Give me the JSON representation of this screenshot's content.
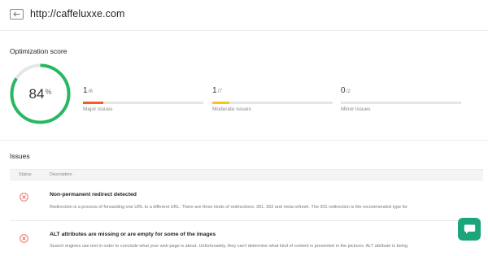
{
  "header": {
    "back_icon": "arrow-left-icon",
    "url": "http://caffeluxxe.com"
  },
  "score": {
    "title": "Optimization score",
    "value": "84",
    "unit": "%",
    "fraction": 0.84,
    "color": "#27b862"
  },
  "stats": [
    {
      "count": "1",
      "total": "/6",
      "label": "Major issues",
      "fraction": 0.167,
      "color": "#f25b2a"
    },
    {
      "count": "1",
      "total": "/7",
      "label": "Moderate issues",
      "fraction": 0.143,
      "color": "#f5c523"
    },
    {
      "count": "0",
      "total": "/2",
      "label": "Minor issues",
      "fraction": 0,
      "color": "#27b862"
    }
  ],
  "issues": {
    "title": "Issues",
    "columns": {
      "status": "Status",
      "description": "Description"
    },
    "rows": [
      {
        "icon": "error-x-icon",
        "title": "Non-permanent redirect detected",
        "desc": "Redirection is a process of forwarding one URL to a different URL. There are three kinds of redirections: 301, 302 and meta refresh. The 301 redirection is the recommended type for"
      },
      {
        "icon": "error-x-icon",
        "title": "ALT attributes are missing or are empty for some of the images",
        "desc": "Search engines use text in order to conclude what your web page is about. Unfortunately, they can't determine what kind of content is presented in the pictures. ALT attribute is being"
      }
    ]
  },
  "chat": {
    "icon": "chat-bubble-icon",
    "color": "#1aa57a"
  }
}
